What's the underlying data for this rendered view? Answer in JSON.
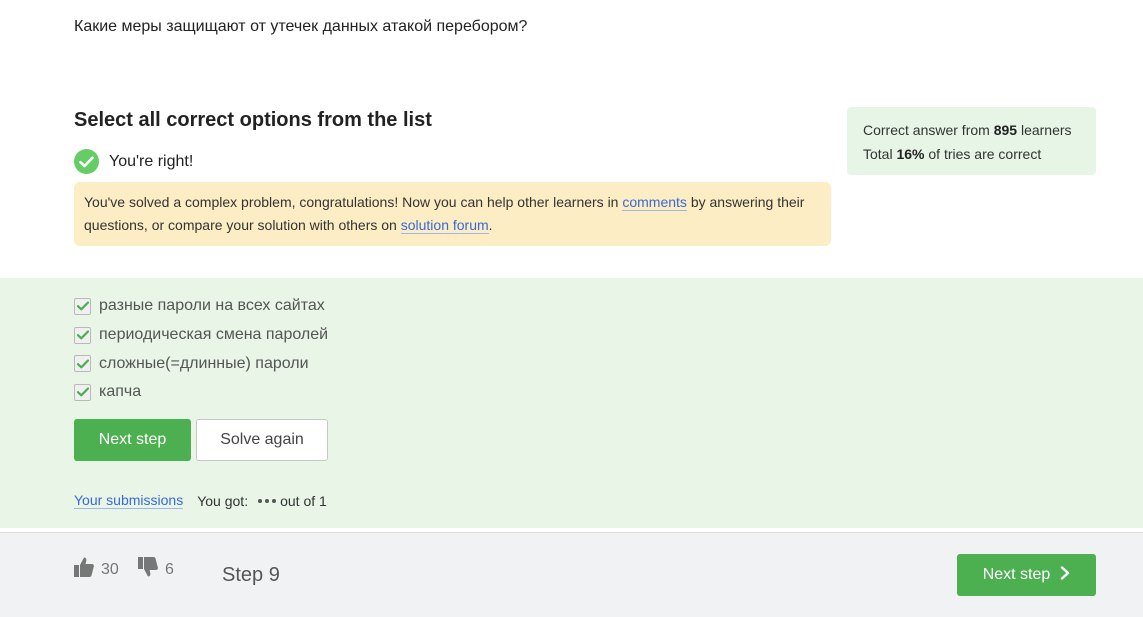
{
  "question": "Какие меры защищают от утечек данных атакой перебором?",
  "heading": "Select all correct options from the list",
  "feedback": {
    "status": "You're right!",
    "message_part1": "You've solved a complex problem, congratulations! Now you can help other learners in ",
    "comments_link": "comments",
    "message_part2": " by answering their questions, or compare your solution with others on ",
    "forum_link": "solution forum",
    "message_part3": "."
  },
  "stats": {
    "line1_prefix": "Correct answer from ",
    "learners_count": "895",
    "line1_suffix": " learners",
    "line2_prefix": "Total ",
    "percent": "16%",
    "line2_suffix": " of tries are correct"
  },
  "options": [
    {
      "label": "разные пароли на всех сайтах",
      "checked": true
    },
    {
      "label": "периодическая смена паролей",
      "checked": true
    },
    {
      "label": "сложные(=длинные) пароли",
      "checked": true
    },
    {
      "label": "капча",
      "checked": true
    }
  ],
  "buttons": {
    "next_step": "Next step",
    "solve_again": "Solve again"
  },
  "submissions": {
    "link": "Your submissions",
    "you_got": "You got:",
    "out_of": "out of 1"
  },
  "footer": {
    "likes": "30",
    "dislikes": "6",
    "step": "Step 9",
    "next_step": "Next step"
  },
  "colors": {
    "accent_green": "#4caf50",
    "success_bg": "#e8f5e7",
    "notice_bg": "#fdedc4",
    "link": "#3869d4"
  },
  "icons": [
    "check-circle-icon",
    "checkbox-checked-icon",
    "thumbs-up-icon",
    "thumbs-down-icon",
    "chevron-right-icon"
  ]
}
